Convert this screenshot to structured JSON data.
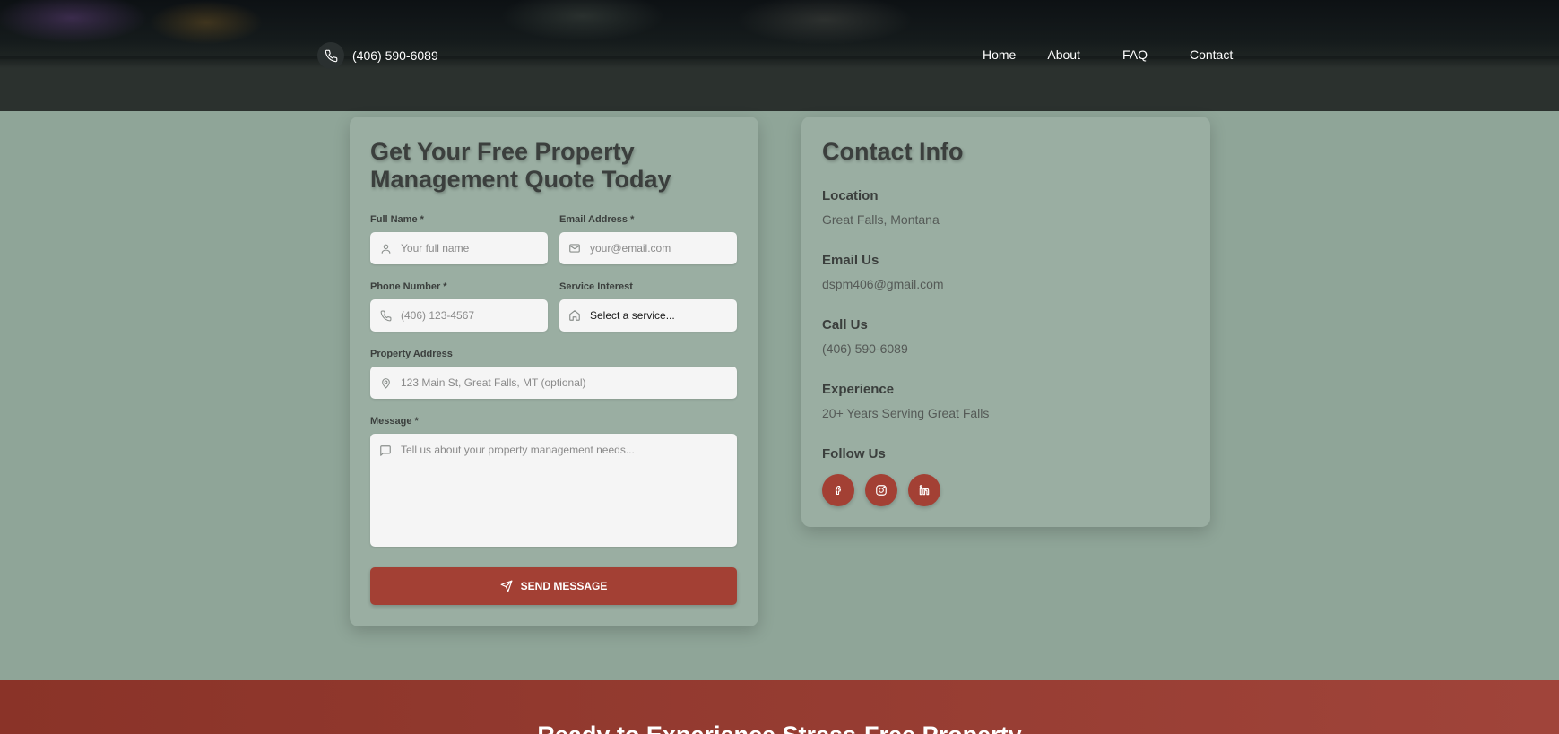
{
  "header": {
    "phone": "(406) 590-6089",
    "nav": [
      "Home",
      "About",
      "FAQ",
      "Contact"
    ]
  },
  "form": {
    "title": "Get Your Free Property Management Quote Today",
    "full_name": {
      "label": "Full Name *",
      "placeholder": "Your full name"
    },
    "email": {
      "label": "Email Address *",
      "placeholder": "your@email.com"
    },
    "phone": {
      "label": "Phone Number *",
      "placeholder": "(406) 123-4567"
    },
    "service": {
      "label": "Service Interest",
      "selected": "Select a service..."
    },
    "address": {
      "label": "Property Address",
      "placeholder": "123 Main St, Great Falls, MT (optional)"
    },
    "message": {
      "label": "Message *",
      "placeholder": "Tell us about your property management needs..."
    },
    "submit_label": "SEND MESSAGE"
  },
  "contact_info": {
    "title": "Contact Info",
    "location": {
      "heading": "Location",
      "value": "Great Falls, Montana"
    },
    "email": {
      "heading": "Email Us",
      "value": "dspm406@gmail.com"
    },
    "call": {
      "heading": "Call Us",
      "value": "(406) 590-6089"
    },
    "experience": {
      "heading": "Experience",
      "value": "20+ Years Serving Great Falls"
    },
    "follow": {
      "heading": "Follow Us",
      "icons": [
        "facebook-icon",
        "instagram-icon",
        "linkedin-icon"
      ]
    }
  },
  "banner": {
    "title": "Ready to Experience Stress-Free Property"
  },
  "colors": {
    "accent": "#a34034",
    "page_bg": "#8fa598",
    "card_bg": "#9aaea2",
    "header_bg": "#2b312e"
  }
}
